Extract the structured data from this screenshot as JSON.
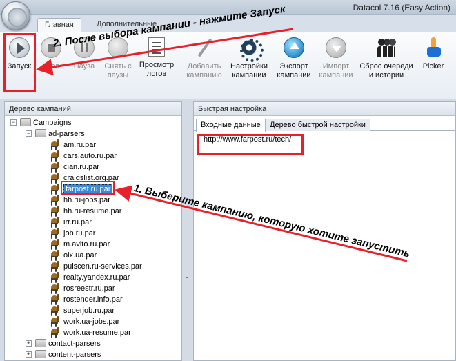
{
  "app": {
    "title": "Datacol 7.16 (Easy Action)"
  },
  "tabs": [
    {
      "label": "Главная"
    },
    {
      "label": "Дополнительные"
    }
  ],
  "ribbon": {
    "start": "Запуск",
    "stop": "Стоп",
    "pause": "Пауза",
    "unpause": "Снять с\nпаузы",
    "logs": "Просмотр\nлогов",
    "add_campaign": "Добавить\nкампанию",
    "campaign_settings": "Настройки\nкампании",
    "export": "Экспорт\nкампании",
    "import": "Импорт\nкампании",
    "reset": "Сброс очереди\nи истории",
    "picker": "Picker"
  },
  "left_panel": {
    "header": "Дерево кампаний",
    "root": "Campaigns",
    "folders": [
      "ad-parsers",
      "contact-parsers",
      "content-parsers"
    ],
    "files": [
      "am.ru.par",
      "cars.auto.ru.par",
      "cian.ru.par",
      "craigslist.org.par",
      "farpost.ru.par",
      "hh.ru-jobs.par",
      "hh.ru-resume.par",
      "irr.ru.par",
      "job.ru.par",
      "m.avito.ru.par",
      "olx.ua.par",
      "pulscen.ru-services.par",
      "realty.yandex.ru.par",
      "rosreestr.ru.par",
      "rostender.info.par",
      "superjob.ru.par",
      "work.ua-jobs.par",
      "work.ua-resume.par"
    ]
  },
  "right_panel": {
    "header": "Быстрая настройка",
    "tab_input": "Входные данные",
    "tab_tree": "Дерево быстрой настройки",
    "url": "http://www.farpost.ru/tech/"
  },
  "annotations": {
    "step2": "2. После выбора кампании - нажмите Запуск",
    "step1": "1. Выберите кампанию, которую хотите запустить"
  },
  "colors": {
    "annotation_red": "#e8202a",
    "selection": "#3b88d8"
  }
}
